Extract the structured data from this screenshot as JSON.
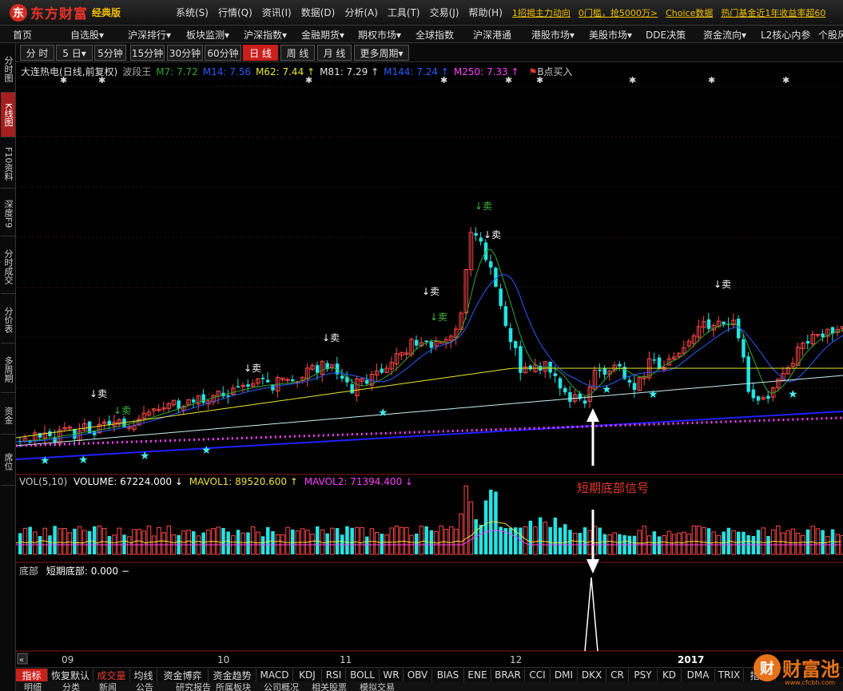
{
  "app": {
    "logo_mark": "东",
    "name": "东方财富",
    "edition": "经典版"
  },
  "menu": [
    "系统(S)",
    "行情(Q)",
    "资讯(I)",
    "数据(D)",
    "分析(A)",
    "工具(T)",
    "交易(J)",
    "帮助(H)"
  ],
  "news": [
    "1招揭主力动向",
    "0门槛，抢5000万>",
    "Choice数据",
    "热门基金近1年收益率超60"
  ],
  "nav": [
    "首页",
    "自选股▾",
    "沪深排行▾",
    "板块监测▾",
    "沪深指数▾",
    "金融期货▾",
    "期权市场▾",
    "全球指数",
    "沪深港通",
    "港股市场▾",
    "美股市场▾",
    "DDE决策",
    "资金流向▾",
    "L2核心内参",
    "个股风"
  ],
  "sidebar": [
    "分时图",
    "K线图",
    "F10资料",
    "深度F9",
    "分时成交",
    "分价表",
    "多周期",
    "资金",
    "席位"
  ],
  "periods": [
    "分 时",
    "5 日▾",
    "5分钟",
    "15分钟",
    "30分钟",
    "60分钟",
    "日 线",
    "周 线",
    "月 线",
    "更多周期▾"
  ],
  "legend": {
    "stock": "大连热电",
    "mode": "(日线,前复权)",
    "indicator": "波段王",
    "ma": [
      {
        "label": "M7: 7.72",
        "color": "#2fa82f"
      },
      {
        "label": "M14: 7.56",
        "color": "#2a5cff"
      },
      {
        "label": "M62: 7.44 ↑",
        "color": "#e8e830"
      },
      {
        "label": "M81: 7.29 ↑",
        "color": "#e0e0e0"
      },
      {
        "label": "M144: 7.24 ↑",
        "color": "#2a5cff"
      },
      {
        "label": "M250: 7.33 ↑",
        "color": "#ff40ff"
      }
    ],
    "signal": "B点买入"
  },
  "sell_label": "↓卖",
  "volume": {
    "label": "VOL(5,10)",
    "volume": "VOLUME: 67224.000 ↓",
    "mavol1": "MAVOL1: 89520.600 ↑",
    "mavol2": "MAVOL2: 71394.400 ↓"
  },
  "bottom_indicator": {
    "name": "底部",
    "value": "短期底部: 0.000 −"
  },
  "annotation": "短期底部信号",
  "x_axis": [
    "09",
    "10",
    "11",
    "12",
    "2017"
  ],
  "tabs": [
    "指标",
    "恢复默认",
    "成交量",
    "均线",
    "资金博弈",
    "资金趋势",
    "MACD",
    "KDJ",
    "RSI",
    "BOLL",
    "WR",
    "OBV",
    "BIAS",
    "ENE",
    "BRAR",
    "CCI",
    "DMI",
    "DKX",
    "CR",
    "PSY",
    "KD",
    "DMA",
    "TRIX",
    "指数"
  ],
  "bottom_labels": [
    "明细",
    "分类",
    "新闻",
    "公告",
    "研究报告",
    "所属板块",
    "公司概况",
    "相关股票",
    "模拟交易"
  ],
  "watermark": {
    "mark": "财",
    "text": "财富池",
    "url": "www.cfcbh.com"
  },
  "colors": {
    "up": "#ff4848",
    "down": "#25e3e3",
    "accent": "#c9201c"
  }
}
